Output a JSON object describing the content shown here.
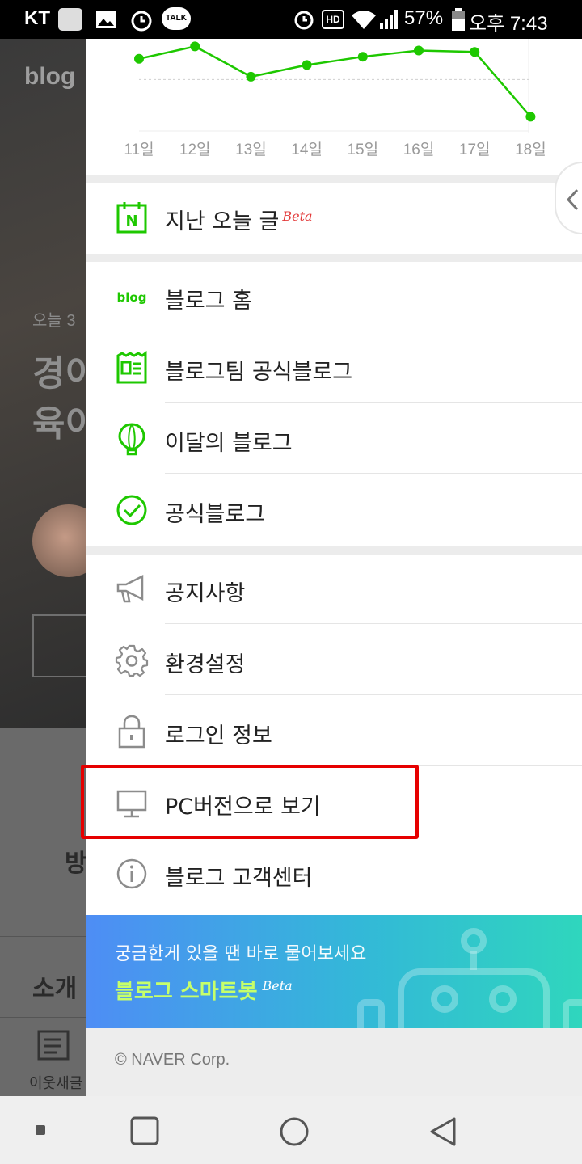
{
  "status_bar": {
    "carrier": "KT",
    "battery": "57%",
    "time": "오후 7:43",
    "icons": [
      "image-icon",
      "alarm-icon",
      "kakaotalk-icon",
      "clock-icon",
      "hd-icon",
      "wifi-icon",
      "signal-icon",
      "battery-icon"
    ],
    "talk_label": "TALK",
    "hd_label": "HD"
  },
  "background_app": {
    "logo": "blog",
    "today_prefix": "오늘 3",
    "title_line1": "경이",
    "title_line2": "육이",
    "visit_label": "방",
    "intro_label": "소개",
    "neighbor_posts_label": "이웃새글"
  },
  "drawer": {
    "chart_data": {
      "type": "line",
      "categories": [
        "11일",
        "12일",
        "13일",
        "14일",
        "15일",
        "16일",
        "17일",
        "18일"
      ],
      "values": [
        58,
        76,
        32,
        49,
        61,
        70,
        68,
        -26
      ],
      "ylim": [
        -35,
        80
      ],
      "reference_line": 28,
      "color": "#1ec800",
      "grid": false
    },
    "past_today": {
      "label": "지난 오늘 글",
      "beta": "Beta"
    },
    "section1": [
      {
        "label": "블로그 홈",
        "icon": "blog-logo-icon"
      },
      {
        "label": "블로그팀 공식블로그",
        "icon": "blog-team-icon"
      },
      {
        "label": "이달의 블로그",
        "icon": "balloon-icon"
      },
      {
        "label": "공식블로그",
        "icon": "check-circle-icon"
      }
    ],
    "section2": [
      {
        "label": "공지사항",
        "icon": "megaphone-icon"
      },
      {
        "label": "환경설정",
        "icon": "gear-icon"
      },
      {
        "label": "로그인 정보",
        "icon": "lock-icon"
      },
      {
        "label": "PC버전으로 보기",
        "icon": "monitor-icon"
      },
      {
        "label": "블로그 고객센터",
        "icon": "info-icon"
      }
    ],
    "blog_icon_text": "blog",
    "calendar_icon_text": "N",
    "smartbot": {
      "question": "궁금한게 있을 땐 바로 물어보세요",
      "name": "블로그 스마트봇",
      "beta": "Beta"
    },
    "footer": "© NAVER Corp."
  },
  "colors": {
    "accent_green": "#1ec800",
    "highlight_red": "#e60000",
    "smartbot_gradient_start": "#4e8df5",
    "smartbot_gradient_end": "#2fd6bd"
  }
}
